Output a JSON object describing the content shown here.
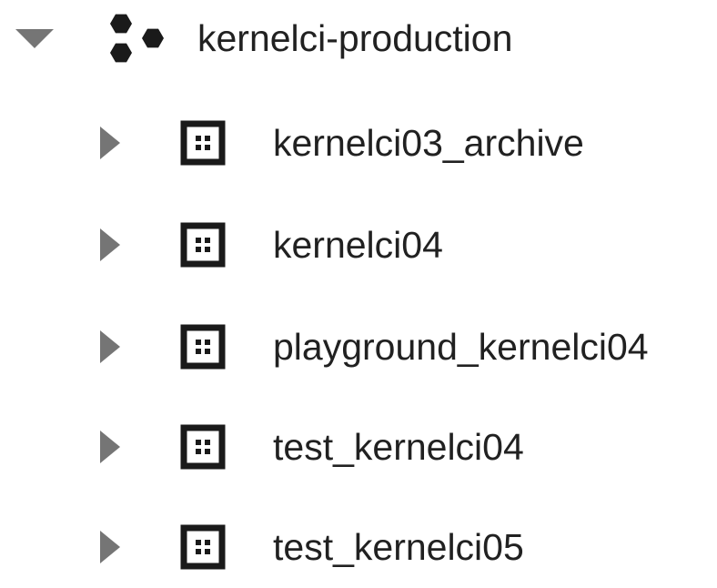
{
  "tree": {
    "project": {
      "name": "kernelci-production",
      "expanded": true,
      "toggle_icon": "arrow-down-icon",
      "icon": "project-hexagons-icon"
    },
    "datasets": [
      {
        "name": "kernelci03_archive",
        "expanded": false,
        "toggle_icon": "arrow-right-icon",
        "icon": "dataset-icon"
      },
      {
        "name": "kernelci04",
        "expanded": false,
        "toggle_icon": "arrow-right-icon",
        "icon": "dataset-icon"
      },
      {
        "name": "playground_kernelci04",
        "expanded": false,
        "toggle_icon": "arrow-right-icon",
        "icon": "dataset-icon"
      },
      {
        "name": "test_kernelci04",
        "expanded": false,
        "toggle_icon": "arrow-right-icon",
        "icon": "dataset-icon"
      },
      {
        "name": "test_kernelci05",
        "expanded": false,
        "toggle_icon": "arrow-right-icon",
        "icon": "dataset-icon"
      }
    ]
  },
  "colors": {
    "text": "#212121",
    "toggle": "#757575",
    "icon": "#1a1a1a"
  }
}
